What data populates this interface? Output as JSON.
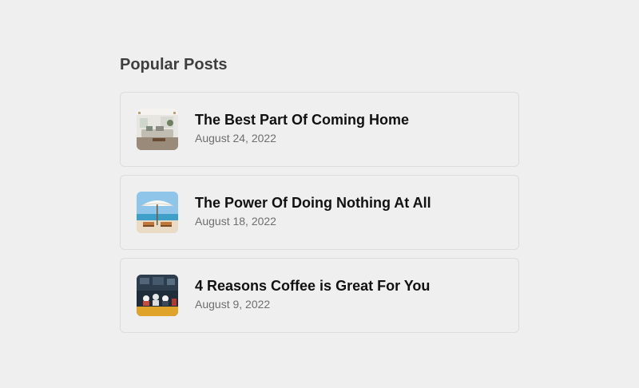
{
  "section": {
    "heading": "Popular Posts"
  },
  "posts": [
    {
      "title": "The Best Part Of Coming Home",
      "date": "August 24, 2022",
      "thumbnail": "living-room-photo"
    },
    {
      "title": "The Power Of Doing Nothing At All",
      "date": "August 18, 2022",
      "thumbnail": "beach-umbrella-photo"
    },
    {
      "title": "4 Reasons Coffee is Great For You",
      "date": "August 9, 2022",
      "thumbnail": "coffee-shop-photo"
    }
  ]
}
